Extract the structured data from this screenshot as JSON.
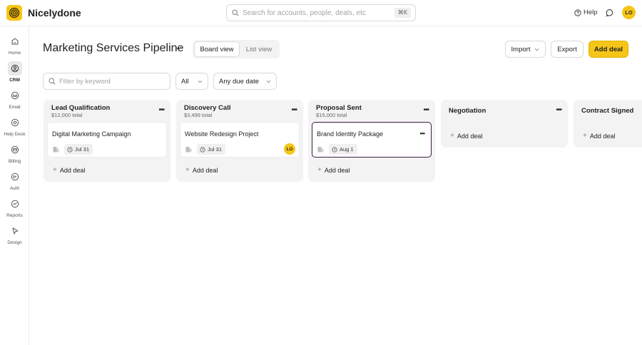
{
  "app": {
    "name": "Nicelydone"
  },
  "search": {
    "placeholder": "Search for accounts, people, deals, etc",
    "shortcut": "⌘K"
  },
  "header": {
    "help_label": "Help",
    "user_initials": "LO"
  },
  "sidebar": {
    "items": [
      {
        "label": "Home",
        "icon": "home-icon",
        "active": false
      },
      {
        "label": "CRM",
        "icon": "crm-icon",
        "active": true
      },
      {
        "label": "Email",
        "icon": "email-icon",
        "active": false
      },
      {
        "label": "Help Desk",
        "icon": "help-desk-icon",
        "active": false
      },
      {
        "label": "Billing",
        "icon": "billing-icon",
        "active": false
      },
      {
        "label": "Auth",
        "icon": "auth-icon",
        "active": false
      },
      {
        "label": "Reports",
        "icon": "reports-icon",
        "active": false
      },
      {
        "label": "Design",
        "icon": "design-icon",
        "active": false
      }
    ]
  },
  "page": {
    "title": "Marketing Services Pipeline",
    "views": {
      "board": "Board view",
      "list": "List view",
      "active": "board"
    },
    "actions": {
      "import": "Import",
      "export": "Export",
      "add_deal": "Add deal"
    }
  },
  "filters": {
    "keyword_placeholder": "Filter by keyword",
    "owner": "All",
    "due_date": "Any due date"
  },
  "board": {
    "add_deal_label": "Add deal",
    "columns": [
      {
        "name": "Lead Qualification",
        "total": "$12,000 total",
        "deals": [
          {
            "title": "Digital Marketing Campaign",
            "due": "Jul 31",
            "owner": ""
          }
        ]
      },
      {
        "name": "Discovery Call",
        "total": "$3,499 total",
        "deals": [
          {
            "title": "Website Redesign Project",
            "due": "Jul 31",
            "owner": "LO"
          }
        ]
      },
      {
        "name": "Proposal Sent",
        "total": "$15,000 total",
        "deals": [
          {
            "title": "Brand Identity Package",
            "due": "Aug 1",
            "owner": "",
            "selected": true
          }
        ]
      },
      {
        "name": "Negotiation",
        "total": "",
        "deals": []
      },
      {
        "name": "Contract Signed",
        "total": "",
        "deals": []
      }
    ]
  },
  "colors": {
    "accent": "#f5c518",
    "selected_border": "#3b1d3f",
    "column_bg": "#f3f3f3"
  }
}
